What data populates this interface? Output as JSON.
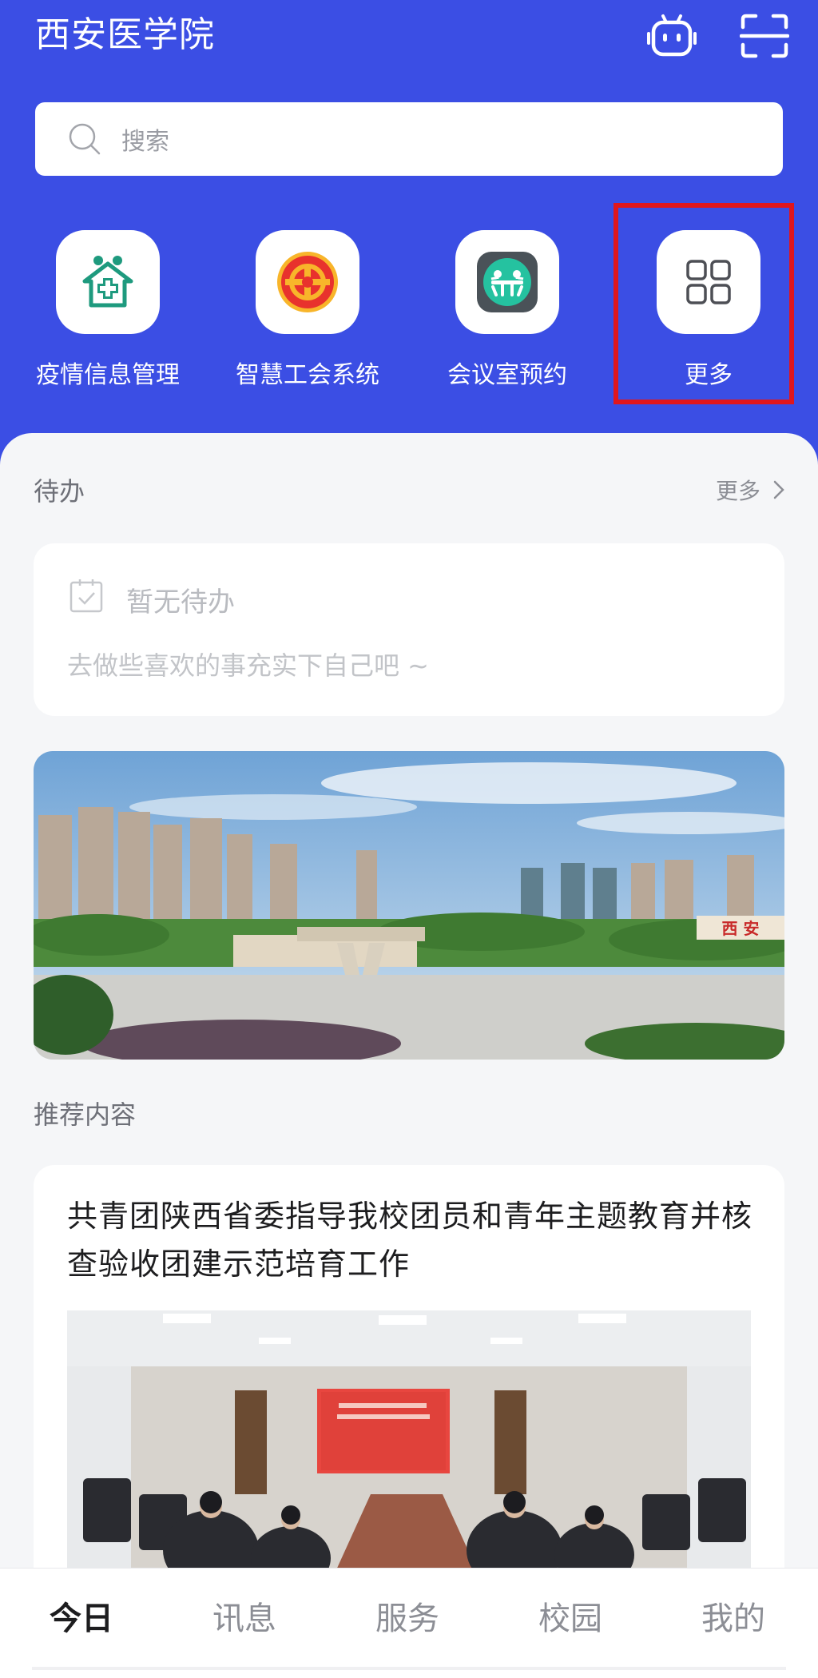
{
  "header": {
    "title": "西安医学院",
    "robot_icon": "robot-icon",
    "scan_icon": "scan-icon",
    "bg_color": "#3b4ee4"
  },
  "search": {
    "placeholder": "搜索"
  },
  "apps": [
    {
      "label": "疫情信息管理",
      "icon": "epidemic-house-icon"
    },
    {
      "label": "智慧工会系统",
      "icon": "trade-union-emblem-icon"
    },
    {
      "label": "会议室预约",
      "icon": "meeting-room-icon"
    },
    {
      "label": "更多",
      "icon": "grid-more-icon"
    }
  ],
  "highlight_color": "#e0161d",
  "todo": {
    "section_title": "待办",
    "more_label": "更多",
    "empty_title": "暂无待办",
    "empty_hint": "去做些喜欢的事充实下自己吧 ~"
  },
  "banner": {
    "sign_text": "西 安"
  },
  "recommend": {
    "section_title": "推荐内容",
    "article_title": "共青团陕西省委指导我校团员和青年主题教育并核查验收团建示范培育工作"
  },
  "bottom_nav": [
    {
      "label": "今日",
      "active": true
    },
    {
      "label": "讯息",
      "active": false
    },
    {
      "label": "服务",
      "active": false
    },
    {
      "label": "校园",
      "active": false
    },
    {
      "label": "我的",
      "active": false
    }
  ]
}
